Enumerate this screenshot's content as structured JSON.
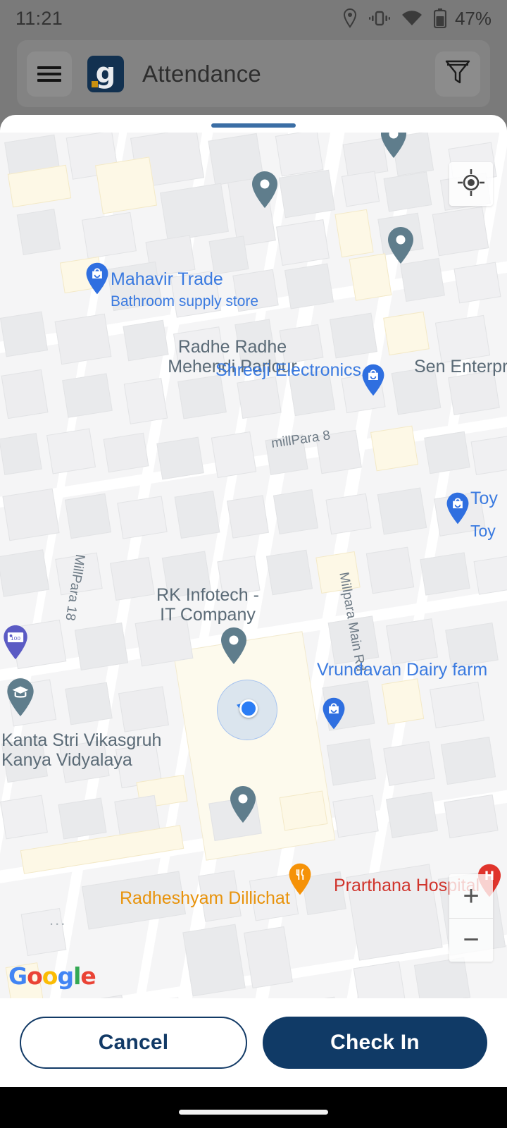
{
  "status_bar": {
    "time": "11:21",
    "battery_percent": "47%",
    "icons": [
      "location-icon",
      "vibrate-icon",
      "wifi-icon",
      "battery-icon"
    ]
  },
  "app_bar": {
    "menu_icon": "hamburger-menu-icon",
    "logo_letter": "g",
    "title": "Attendance",
    "filter_icon": "filter-funnel-icon"
  },
  "sheet": {
    "grabber": "drag-handle",
    "grabber_color": "#3b6ea5"
  },
  "map": {
    "provider_watermark": "Google",
    "my_location_button": "my-location-crosshair",
    "zoom_in_label": "+",
    "zoom_out_label": "−",
    "current_location": {
      "label": "current-position-blue-dot",
      "accent": "#2b7df5"
    },
    "labels": [
      {
        "name": "Radhe Radhe Mehendi Parlour",
        "lines": [
          "Radhe Radhe",
          "Mehendi Parlour"
        ],
        "kind": "place",
        "color": "#5b6b77"
      },
      {
        "name": "Sen Enterprise",
        "lines": [
          "Sen Enterpr"
        ],
        "kind": "place",
        "color": "#5b6b77"
      },
      {
        "name": "Mahavir Trade",
        "lines": [
          "Mahavir Trade"
        ],
        "sub": "Bathroom supply store",
        "kind": "poi",
        "color": "#3a7ae0"
      },
      {
        "name": "Shreeji Electronics",
        "lines": [
          "Shreeji Electronics"
        ],
        "kind": "poi",
        "color": "#3a7ae0"
      },
      {
        "name": "Toy store",
        "lines": [
          "Toy"
        ],
        "sub": "Toy",
        "kind": "poi",
        "color": "#3a7ae0"
      },
      {
        "name": "RK Infotech - IT Company",
        "lines": [
          "RK Infotech -",
          "IT Company"
        ],
        "kind": "place",
        "color": "#5b6b77"
      },
      {
        "name": "Vrundavan Dairy farm",
        "lines": [
          "Vrundavan Dairy farm"
        ],
        "kind": "poi",
        "color": "#3a7ae0"
      },
      {
        "name": "Kanta Stri Vikasgruh Kanya Vidyalaya",
        "lines": [
          "Kanta Stri Vikasgruh",
          "Kanya Vidyalaya"
        ],
        "kind": "place",
        "color": "#5b6b77"
      },
      {
        "name": "Radheshyam Dillichat",
        "lines": [
          "Radheshyam Dillichat"
        ],
        "kind": "food",
        "color": "#e8930c"
      },
      {
        "name": "Prarthana Hospital",
        "lines": [
          "Prarthana Hospital"
        ],
        "kind": "hospital",
        "color": "#d0342c"
      }
    ],
    "streets": [
      {
        "name": "millPara 8"
      },
      {
        "name": "MillPara 18"
      },
      {
        "name": "Millpara Main Rd"
      }
    ],
    "markers": [
      {
        "name": "gray-pin-top",
        "kind": "generic"
      },
      {
        "name": "gray-pin-radhe-radhe",
        "kind": "generic"
      },
      {
        "name": "gray-pin-sen-enterprise",
        "kind": "generic"
      },
      {
        "name": "blue-shop-pin-mahavir-trade",
        "kind": "shop"
      },
      {
        "name": "blue-shop-pin-shreeji-electronics",
        "kind": "shop"
      },
      {
        "name": "blue-shop-pin-toy-store",
        "kind": "shop"
      },
      {
        "name": "purple-atm-pin",
        "kind": "atm",
        "badge": "100"
      },
      {
        "name": "gray-pin-rk-infotech",
        "kind": "generic"
      },
      {
        "name": "school-pin-kanta-stri-vikasgruh",
        "kind": "school"
      },
      {
        "name": "blue-shop-pin-vrundavan",
        "kind": "shop"
      },
      {
        "name": "gray-pin-radheshyam",
        "kind": "generic"
      },
      {
        "name": "food-pin-radheshyam-dillichat",
        "kind": "food"
      },
      {
        "name": "hospital-pin-prarthana",
        "kind": "hospital",
        "badge": "H"
      }
    ]
  },
  "actions": {
    "cancel_label": "Cancel",
    "checkin_label": "Check In",
    "primary_color": "#103a66"
  },
  "nav_bar": {
    "home_indicator": "home-gesture-pill"
  }
}
